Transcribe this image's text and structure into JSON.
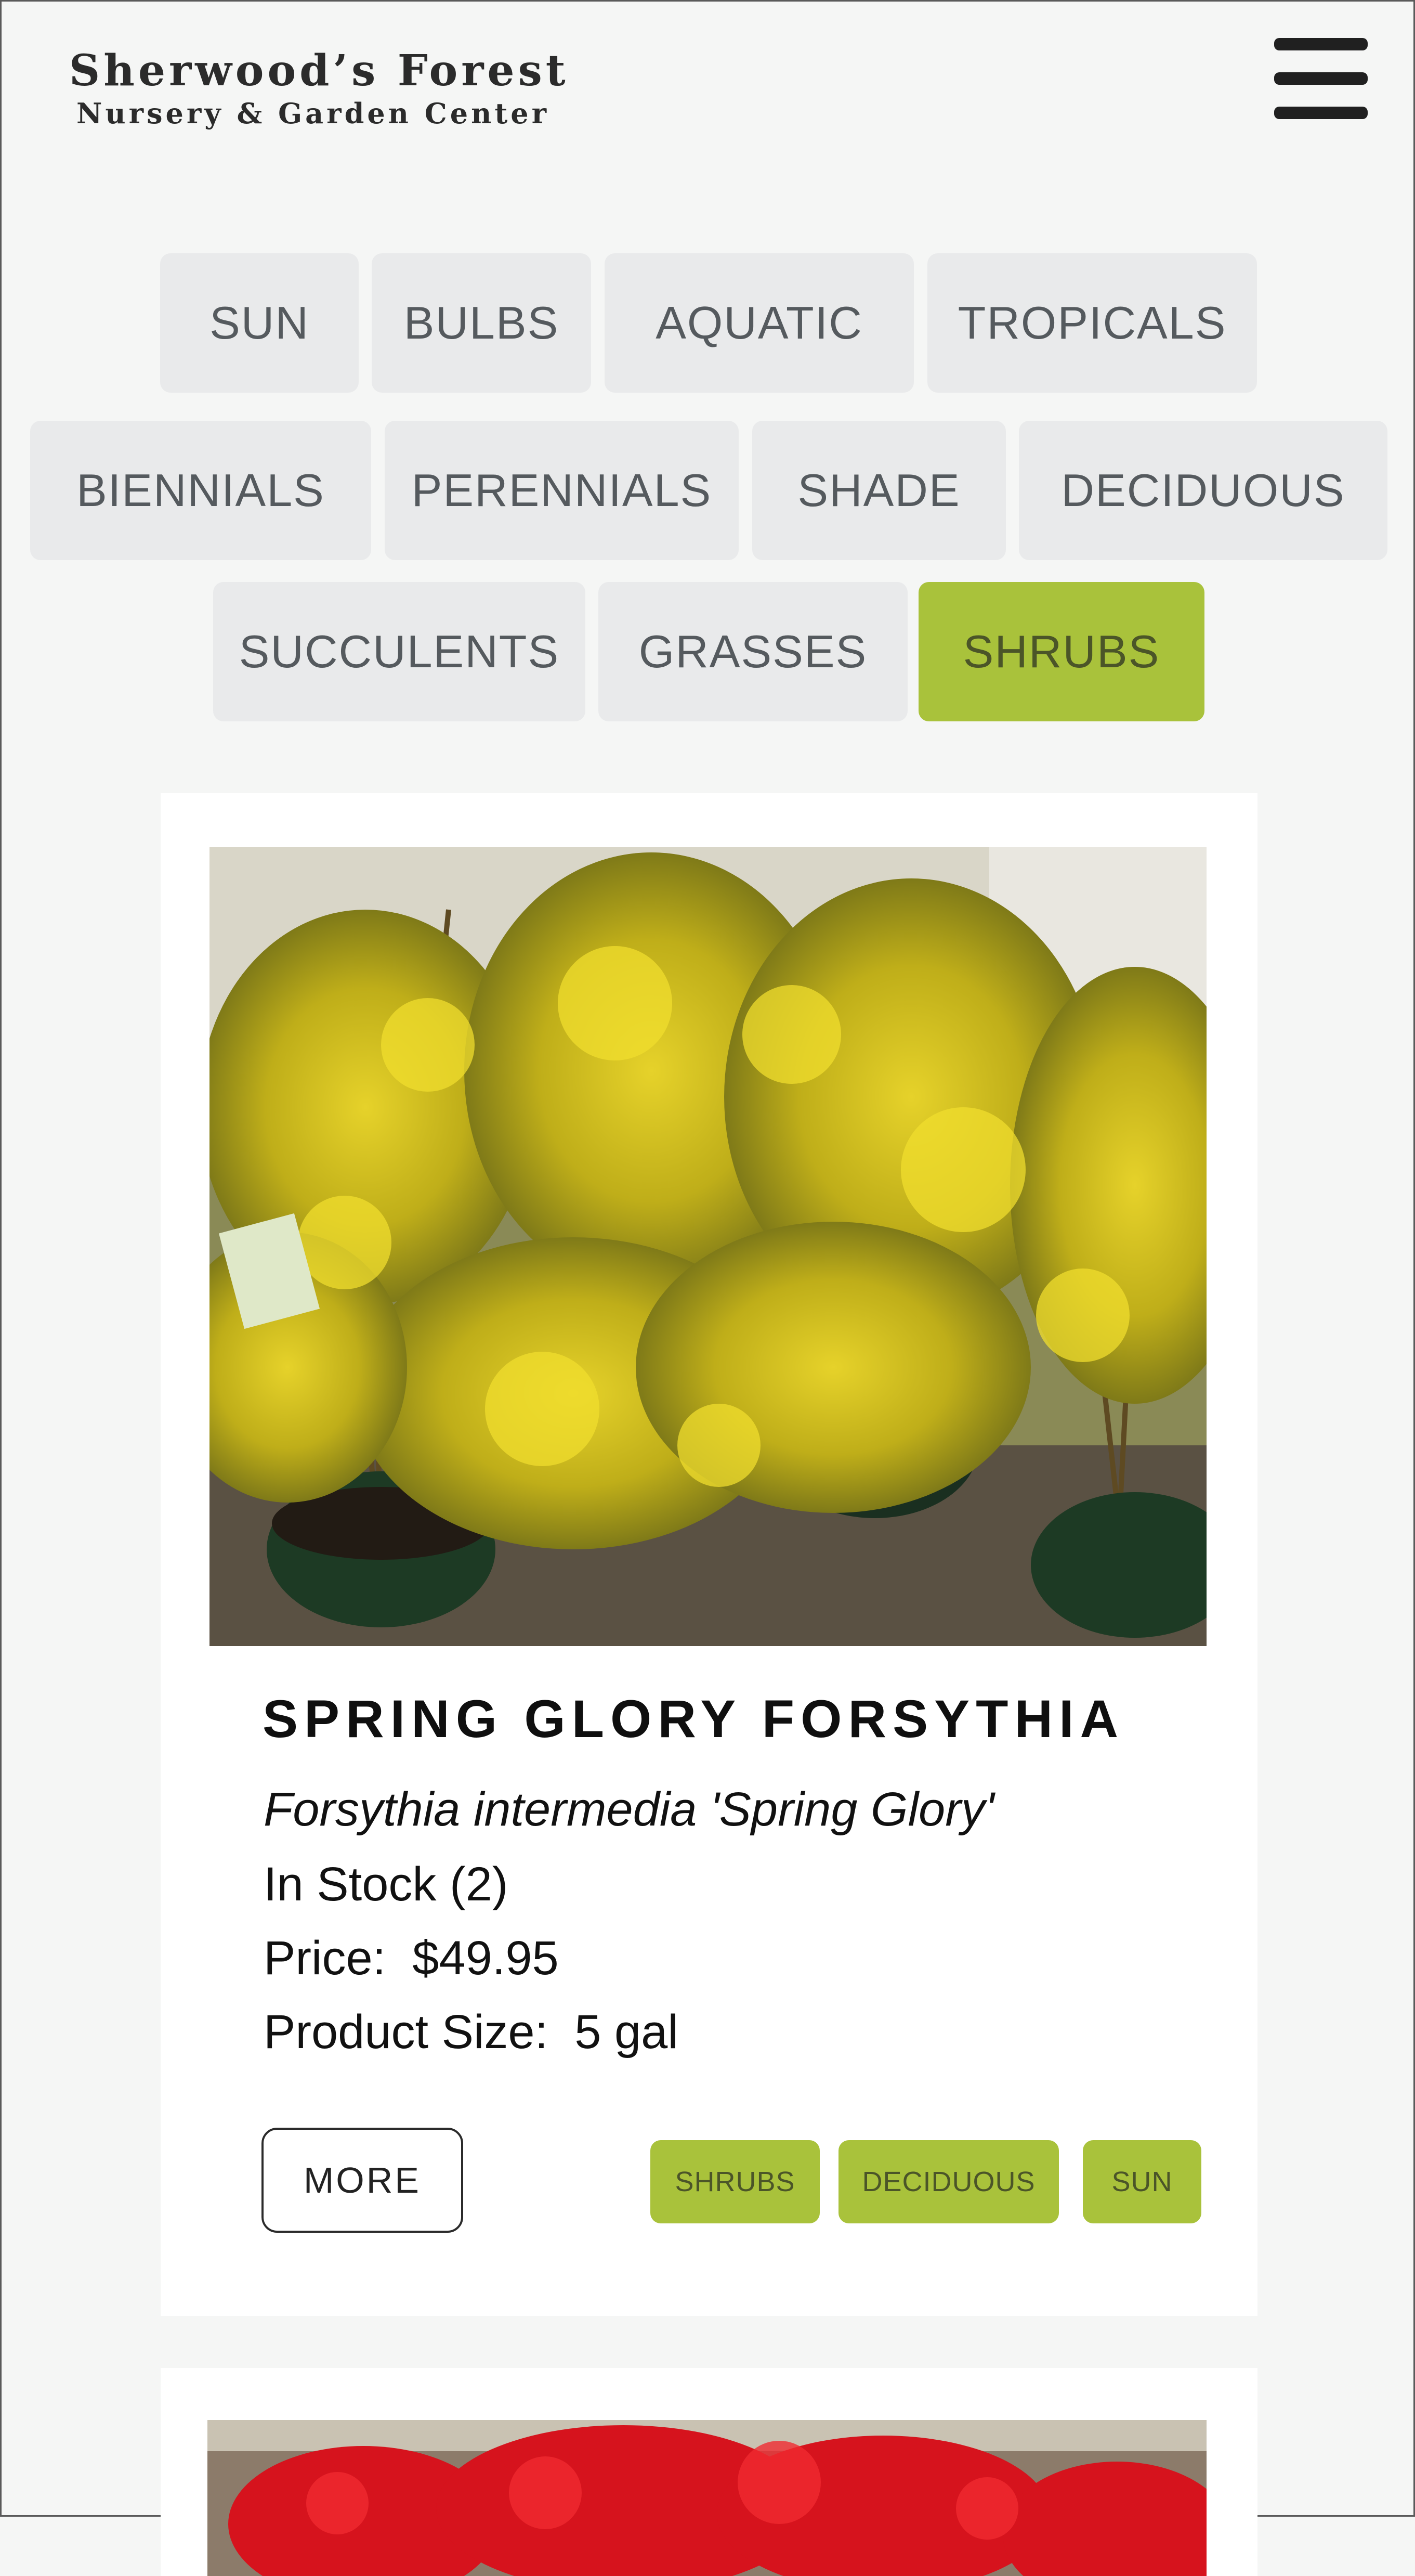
{
  "brand": {
    "title": "Sherwood’s Forest",
    "subtitle": "Nursery & Garden Center"
  },
  "categories": [
    {
      "label": "SUN"
    },
    {
      "label": "BULBS"
    },
    {
      "label": "AQUATIC"
    },
    {
      "label": "TROPICALS"
    },
    {
      "label": "BIENNIALS"
    },
    {
      "label": "PERENNIALS"
    },
    {
      "label": "SHADE"
    },
    {
      "label": "DECIDUOUS"
    },
    {
      "label": "SUCCULENTS"
    },
    {
      "label": "GRASSES"
    },
    {
      "label": "SHRUBS"
    }
  ],
  "active_category": "SHRUBS",
  "product": {
    "name": "SPRING GLORY FORSYTHIA",
    "latin": "Forsythia intermedia 'Spring Glory'",
    "stock": "In Stock (2)",
    "price": "Price:  $49.95",
    "size": "Product Size:  5 gal",
    "more_label": "MORE",
    "tags": [
      "SHRUBS",
      "DECIDUOUS",
      "SUN"
    ]
  },
  "colors": {
    "accent": "#a9c23b",
    "tab_bg": "#e9eaeb",
    "page_bg": "#f5f6f5"
  }
}
